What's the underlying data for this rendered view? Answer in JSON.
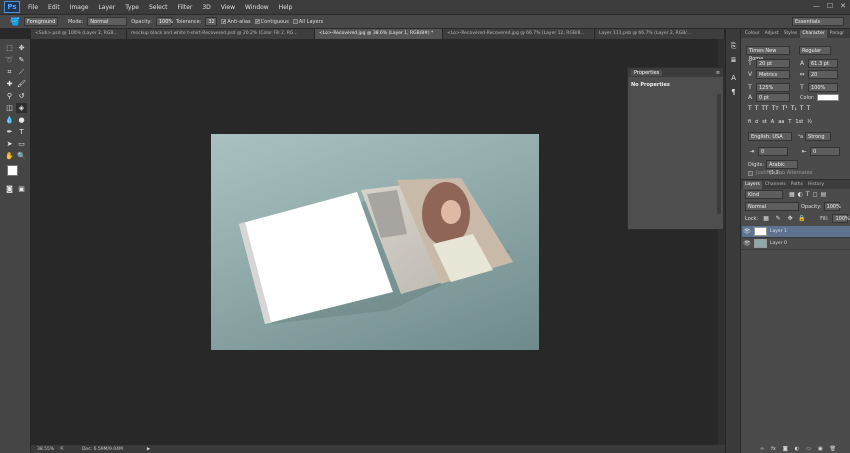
{
  "app": {
    "logo": "Ps"
  },
  "menu": [
    "File",
    "Edit",
    "Image",
    "Layer",
    "Type",
    "Select",
    "Filter",
    "3D",
    "View",
    "Window",
    "Help"
  ],
  "window_controls": {
    "minimize": "—",
    "maximize": "☐",
    "close": "✕"
  },
  "options": {
    "sample": "Foreground",
    "mode_label": "Mode:",
    "mode": "Normal",
    "opacity_label": "Opacity:",
    "opacity": "100%",
    "tolerance_label": "Tolerance:",
    "tolerance": "32",
    "antialias": "Anti-alias",
    "contiguous": "Contiguous",
    "all_layers": "All Layers",
    "workspace": "Essentials"
  },
  "tabs": [
    {
      "label": "<Sub>.psd @ 100% (Layer 2, RGB..."
    },
    {
      "label": "mockup black and white t-shirt-Recovered.psd @ 20.2% (Color Fill 2, RG..."
    },
    {
      "label": "<Lo>-Recovered.jpg @ 38.6% (Layer 1, RGB/8#) *"
    },
    {
      "label": "<Lo>-Recovered-Recovered.jpg @ 66.7% (Layer 12, RGB/8..."
    },
    {
      "label": "Layer 111.psb @ 66.7% (Layer 2, RGB/..."
    }
  ],
  "status": {
    "zoom": "38.55%",
    "doc": "Doc: 6.59M/9.04M"
  },
  "properties": {
    "title": "Properties",
    "content": "No Properties"
  },
  "char_tabs": [
    "Colour",
    "Adjust",
    "Styles",
    "Character",
    "Paragr"
  ],
  "character": {
    "font": "Times New Roma...",
    "style": "Regular",
    "size": "20 pt",
    "leading": "61.3 pt",
    "kerning": "Metrics",
    "tracking": "20",
    "vscale": "125%",
    "hscale": "100%",
    "baseline": "0 pt",
    "color_label": "Color:",
    "language": "English: USA",
    "aa_label": "ᵃa",
    "aa": "Strong",
    "indent1": "0",
    "indent2": "0",
    "digits_label": "Digits:",
    "digits": "Arabic (1,2...",
    "justification": "Justification Alternates"
  },
  "layers_tabs": [
    "Layers",
    "Channels",
    "Paths",
    "History"
  ],
  "layers": {
    "kind": "Kind",
    "blend": "Normal",
    "opacity_label": "Opacity:",
    "opacity": "100%",
    "lock_label": "Lock:",
    "fill_label": "Fill:",
    "fill": "100%",
    "items": [
      {
        "name": "Layer 1"
      },
      {
        "name": "Layer 0"
      }
    ]
  }
}
